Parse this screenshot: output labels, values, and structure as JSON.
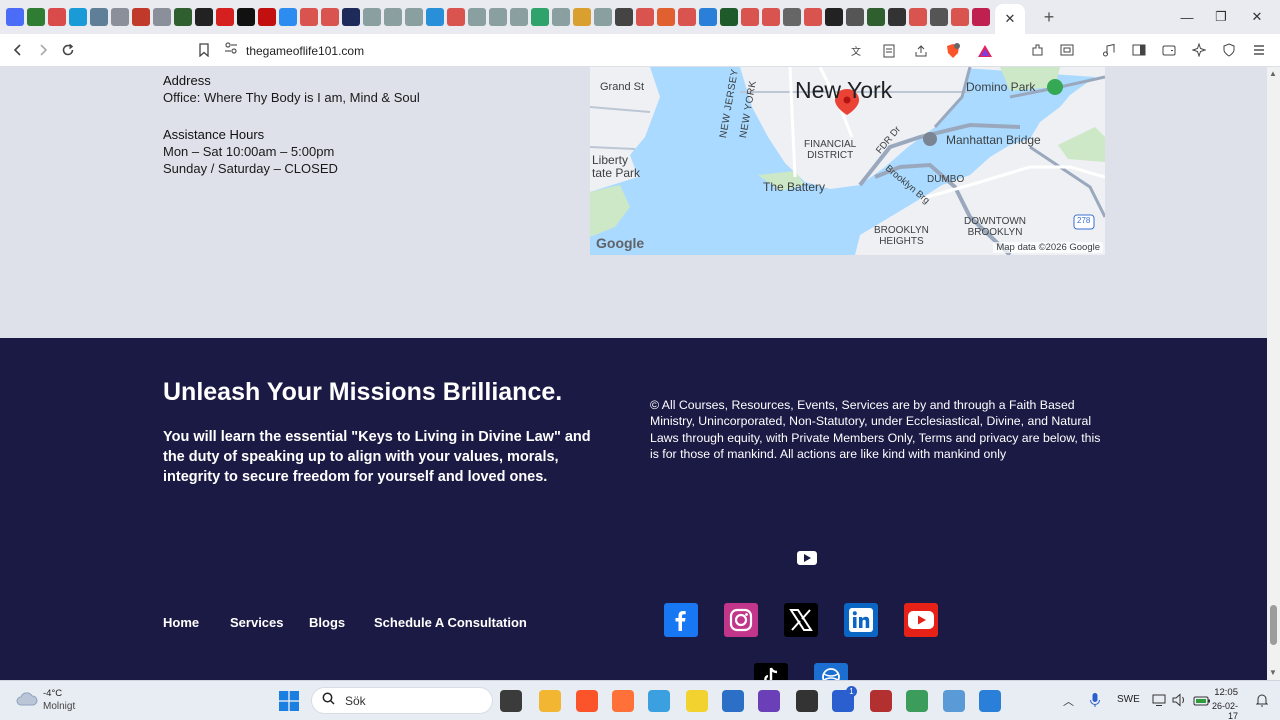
{
  "browser": {
    "url": "thegameoflife101.com",
    "new_tab": "+",
    "close_tab": "✕",
    "window": {
      "minimize": "—",
      "maximize": "❐",
      "close": "✕"
    }
  },
  "contact": {
    "address_heading": "Address",
    "address_line": "Office: Where Thy Body is I am, Mind & Soul",
    "hours_heading": "Assistance Hours",
    "hours_weekday": "Mon – Sat 10:00am – 5:00pm",
    "hours_weekend": "Sunday / Saturday – CLOSED"
  },
  "map": {
    "labels": {
      "grand_st": "Grand St",
      "new_york": "New York",
      "domino_park": "Domino Park",
      "new_jersey": "NEW JERSEY",
      "new_york_state": "NEW YORK",
      "financial_district": "FINANCIAL\nDISTRICT",
      "fdr_dr": "FDR Dr",
      "manhattan_bridge": "Manhattan Bridge",
      "brooklyn_bridge": "Brooklyn Brg",
      "liberty_state_park": "Liberty\ntate Park",
      "the_battery": "The Battery",
      "dumbo": "DUMBO",
      "downtown_brooklyn": "DOWNTOWN\nBROOKLYN",
      "brooklyn_heights": "BROOKLYN\nHEIGHTS",
      "route": "278"
    },
    "google_logo": "Google",
    "attribution": "Map data ©2026 Google"
  },
  "footer": {
    "title": "Unleash Your Missions Brilliance.",
    "description": "You will learn the essential \"Keys to Living in Divine Law\" and the duty of speaking up to align with your values, morals, integrity to secure freedom for yourself and loved ones.",
    "legal": "© All Courses, Resources, Events, Services are by and through a Faith Based Ministry, Unincorporated, Non-Statutory, under Ecclesiastical, Divine, and Natural Laws through equity, with Private Members Only, Terms and privacy are below, this is for those of mankind. All actions are like kind with mankind only",
    "nav": [
      "Home",
      "Services",
      "Blogs",
      "Schedule A Consultation"
    ],
    "social_colors": {
      "facebook": "#1877f2",
      "instagram": "#c1358a",
      "x": "#000000",
      "linkedin": "#0a66c2",
      "youtube": "#e62117"
    }
  },
  "taskbar": {
    "weather_temp": "-4°C",
    "weather_desc": "Molnigt",
    "search_placeholder": "Sök",
    "language": "SWE",
    "time": "12:05",
    "date": "26-02-17",
    "badge_count": "1"
  }
}
